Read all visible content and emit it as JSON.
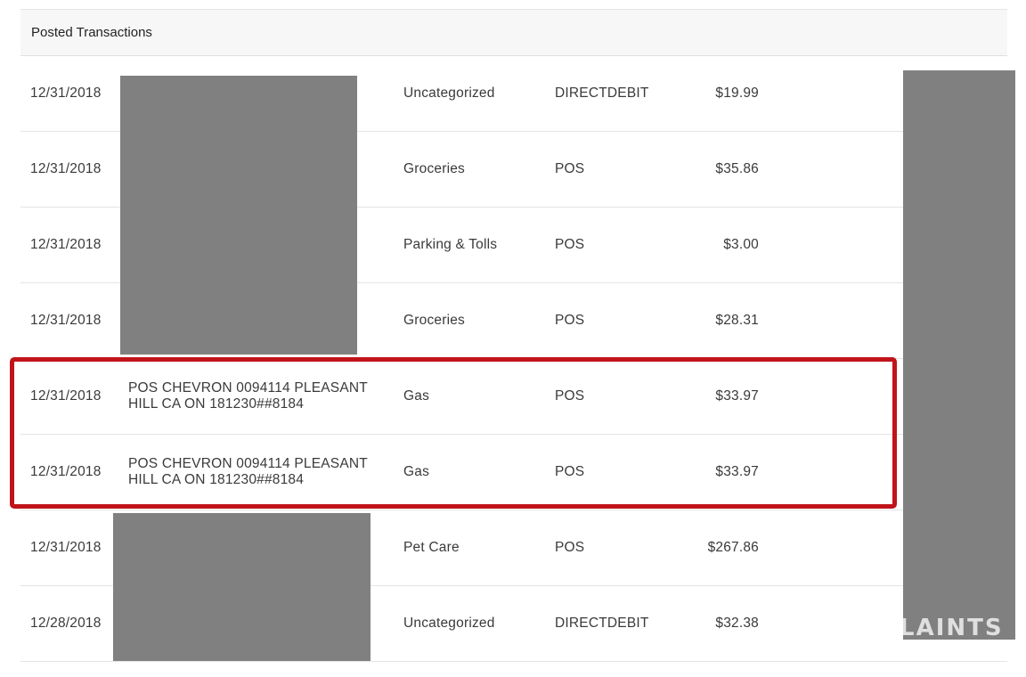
{
  "panel": {
    "title": "Posted Transactions"
  },
  "transactions": [
    {
      "date": "12/31/2018",
      "description": "",
      "category": "Uncategorized",
      "type": "DIRECTDEBIT",
      "amount": "$19.99"
    },
    {
      "date": "12/31/2018",
      "description": "",
      "category": "Groceries",
      "type": "POS",
      "amount": "$35.86"
    },
    {
      "date": "12/31/2018",
      "description": "",
      "category": "Parking & Tolls",
      "type": "POS",
      "amount": "$3.00"
    },
    {
      "date": "12/31/2018",
      "description": "",
      "category": "Groceries",
      "type": "POS",
      "amount": "$28.31"
    },
    {
      "date": "12/31/2018",
      "description": "POS CHEVRON 0094114 PLEASANT HILL CA ON 181230##8184",
      "category": "Gas",
      "type": "POS",
      "amount": "$33.97"
    },
    {
      "date": "12/31/2018",
      "description": "POS CHEVRON 0094114 PLEASANT HILL CA ON 181230##8184",
      "category": "Gas",
      "type": "POS",
      "amount": "$33.97"
    },
    {
      "date": "12/31/2018",
      "description": "",
      "category": "Pet Care",
      "type": "POS",
      "amount": "$267.86"
    },
    {
      "date": "12/28/2018",
      "description": "",
      "category": "Uncategorized",
      "type": "DIRECTDEBIT",
      "amount": "$32.38"
    }
  ],
  "watermark": {
    "text": "LAINTS"
  },
  "colors": {
    "highlight": "#c0141a",
    "redaction": "#808080",
    "header_bg": "#f7f7f7"
  }
}
